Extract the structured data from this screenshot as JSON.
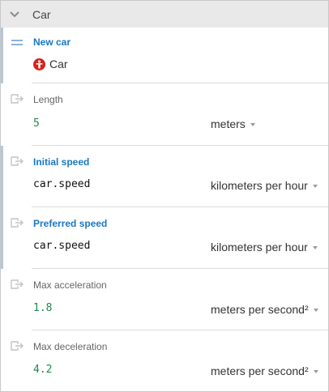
{
  "header": {
    "title": "Car",
    "icon": "chevron-down-icon"
  },
  "entity": {
    "label": "New car",
    "reference": "Car",
    "reference_icon": "car-entity-icon",
    "drag_icon": "drag-handle-icon"
  },
  "properties": [
    {
      "label": "Length",
      "value": "5",
      "unit": "meters",
      "icon": "link-input-icon"
    },
    {
      "label": "Initial speed",
      "value": "car.speed",
      "unit": "kilometers per hour",
      "icon": "link-input-icon"
    },
    {
      "label": "Preferred speed",
      "value": "car.speed",
      "unit": "kilometers per hour",
      "icon": "link-input-icon"
    },
    {
      "label": "Max acceleration",
      "value": "1.8",
      "unit": "meters per second²",
      "icon": "link-input-icon"
    },
    {
      "label": "Max deceleration",
      "value": "4.2",
      "unit": "meters per second²",
      "icon": "link-input-icon"
    }
  ],
  "colors": {
    "header_bg": "#e9e9e9",
    "accent_blue": "#1a78c2",
    "value_green": "#1e8a4a",
    "selection_bar": "#b6c6d9",
    "car_red": "#d9201c"
  }
}
